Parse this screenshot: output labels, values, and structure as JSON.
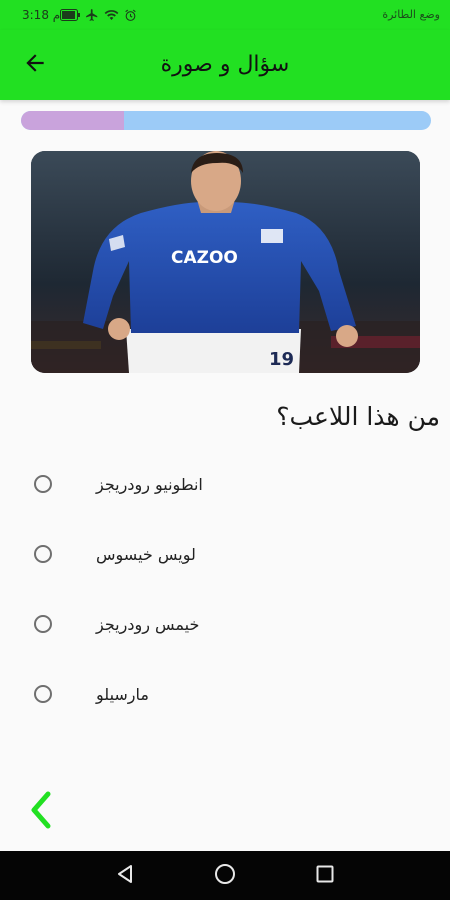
{
  "status_bar": {
    "time": "3:18 م",
    "mode_text": "وضع الطائرة",
    "icons": [
      "battery-icon",
      "airplane-icon",
      "wifi-icon",
      "alarm-icon"
    ]
  },
  "app_bar": {
    "title": "سؤال و صورة",
    "back_icon": "arrow-left-icon",
    "background_color": "#22e022"
  },
  "progress": {
    "fraction": 0.25,
    "fill_color": "#c9a3dc",
    "track_color": "#9ccbf7"
  },
  "question": {
    "image": "football-player-photo",
    "text": "من هذا اللاعب؟"
  },
  "options": [
    {
      "label": "انطونيو رودريجز"
    },
    {
      "label": "لويس خيسوس"
    },
    {
      "label": "خيمس رودريجز"
    },
    {
      "label": "مارسيلو"
    }
  ],
  "navigation": {
    "prev_icon": "chevron-left-icon",
    "accent_color": "#22e022"
  },
  "system_nav": {
    "icons": [
      "back-triangle-icon",
      "home-circle-icon",
      "recents-square-icon"
    ]
  }
}
